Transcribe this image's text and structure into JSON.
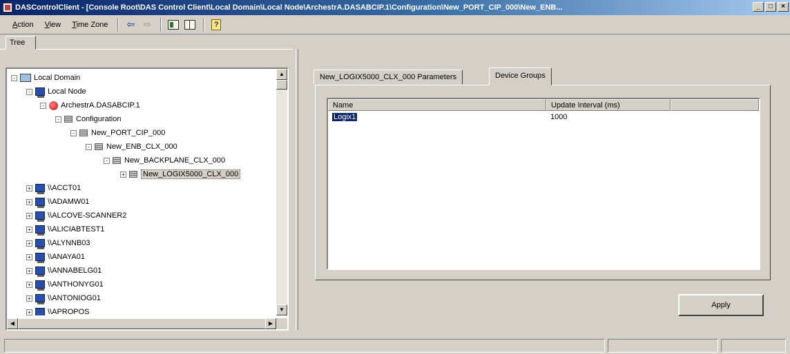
{
  "window": {
    "title": "DASControlClient - [Console Root\\DAS Control Client\\Local Domain\\Local Node\\ArchestrA.DASABCIP.1\\Configuration\\New_PORT_CIP_000\\New_ENB..."
  },
  "menu": {
    "items": [
      "Action",
      "View",
      "Time Zone"
    ]
  },
  "left_pane": {
    "tab_label": "Tree",
    "tree": [
      {
        "label": "Local Domain",
        "icon": "domain-icon",
        "expander": "-"
      },
      {
        "label": "Local Node",
        "icon": "computer-icon",
        "expander": "-"
      },
      {
        "label": "ArchestrA.DASABCIP.1",
        "icon": "object-icon",
        "expander": "-"
      },
      {
        "label": "Configuration",
        "icon": "folder-icon",
        "expander": "-"
      },
      {
        "label": "New_PORT_CIP_000",
        "icon": "folder-icon",
        "expander": "-"
      },
      {
        "label": "New_ENB_CLX_000",
        "icon": "folder-icon",
        "expander": "-"
      },
      {
        "label": "New_BACKPLANE_CLX_000",
        "icon": "folder-icon",
        "expander": "-"
      },
      {
        "label": "New_LOGIX5000_CLX_000",
        "icon": "folder-icon",
        "expander": "+",
        "selected": true
      },
      {
        "label": "\\\\ACCT01",
        "icon": "computer-icon",
        "expander": "+"
      },
      {
        "label": "\\\\ADAMW01",
        "icon": "computer-icon",
        "expander": "+"
      },
      {
        "label": "\\\\ALCOVE-SCANNER2",
        "icon": "computer-icon",
        "expander": "+"
      },
      {
        "label": "\\\\ALICIABTEST1",
        "icon": "computer-icon",
        "expander": "+"
      },
      {
        "label": "\\\\ALYNNB03",
        "icon": "computer-icon",
        "expander": "+"
      },
      {
        "label": "\\\\ANAYA01",
        "icon": "computer-icon",
        "expander": "+"
      },
      {
        "label": "\\\\ANNABELG01",
        "icon": "computer-icon",
        "expander": "+"
      },
      {
        "label": "\\\\ANTHONYG01",
        "icon": "computer-icon",
        "expander": "+"
      },
      {
        "label": "\\\\ANTONIOG01",
        "icon": "computer-icon",
        "expander": "+"
      },
      {
        "label": "\\\\APROPOS",
        "icon": "computer-icon",
        "expander": "+"
      }
    ]
  },
  "right_pane": {
    "tabs": [
      {
        "label": "New_LOGIX5000_CLX_000 Parameters",
        "active": false
      },
      {
        "label": "Device Groups",
        "active": true
      }
    ],
    "list": {
      "columns": [
        "Name",
        "Update Interval (ms)"
      ],
      "rows": [
        {
          "name": "Logix1",
          "interval": "1000",
          "selected": true
        }
      ]
    },
    "apply_label": "Apply"
  }
}
